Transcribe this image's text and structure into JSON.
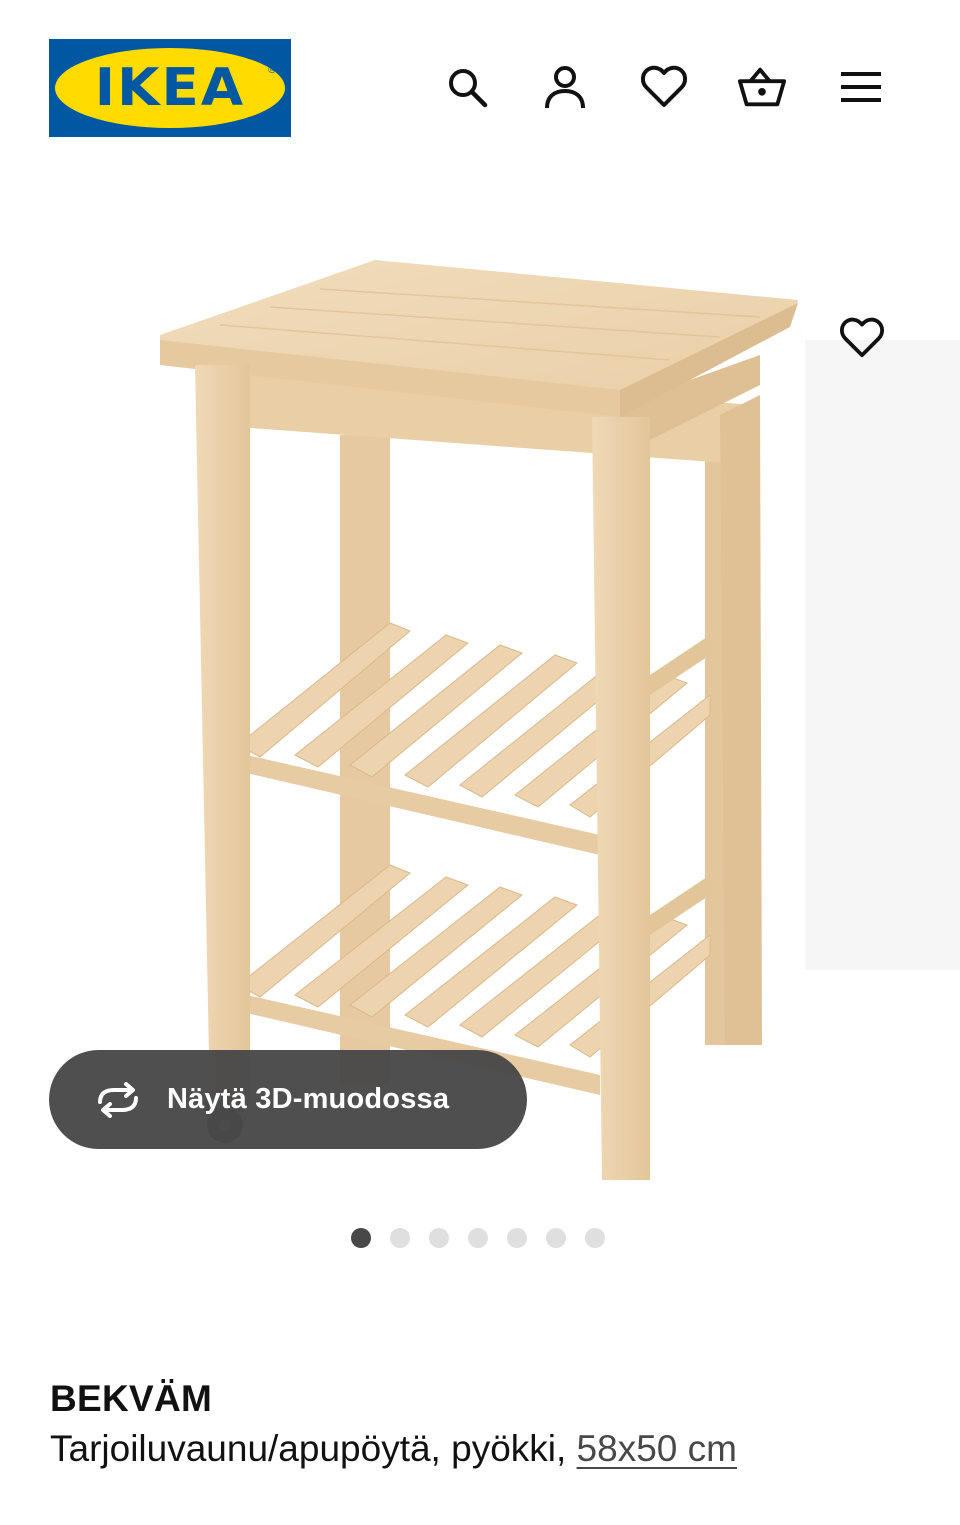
{
  "header": {
    "logo_text": "IKEA",
    "logo_reg_mark": "®",
    "icons": [
      "search-icon",
      "user-icon",
      "heart-icon",
      "basket-icon",
      "menu-icon"
    ]
  },
  "gallery": {
    "view_3d_label": "Näytä 3D-muodossa",
    "view_3d_icon": "rotate-3d-icon",
    "favourite_icon": "heart-icon",
    "image_count": 7,
    "active_image_index": 0
  },
  "product": {
    "name": "BEKVÄM",
    "description": "Tarjoiluvaunu/apupöytä, pyökki,",
    "size": "58x50 cm"
  },
  "colors": {
    "brand_blue": "#0058a3",
    "brand_yellow": "#ffdb00",
    "pill_background": "#484848",
    "dot_active": "#484848",
    "dot_inactive": "#dfdfdf",
    "wood": "#ecd3ad"
  }
}
